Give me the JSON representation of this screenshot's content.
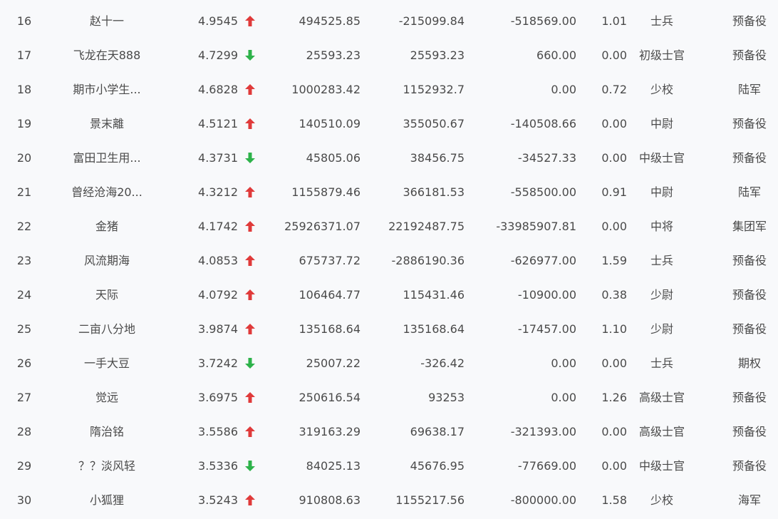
{
  "colors": {
    "up": "#e03a3a",
    "down": "#2db24a"
  },
  "rows": [
    {
      "rank": "16",
      "name": "赵十一",
      "score": "4.9545",
      "trend": "up",
      "v1": "494525.85",
      "v2": "-215099.84",
      "v3": "-518569.00",
      "v4": "1.01",
      "military_rank": "士兵",
      "branch": "预备役"
    },
    {
      "rank": "17",
      "name": "飞龙在天888",
      "score": "4.7299",
      "trend": "down",
      "v1": "25593.23",
      "v2": "25593.23",
      "v3": "660.00",
      "v4": "0.00",
      "military_rank": "初级士官",
      "branch": "预备役"
    },
    {
      "rank": "18",
      "name": "期市小学生...",
      "score": "4.6828",
      "trend": "up",
      "v1": "1000283.42",
      "v2": "1152932.7",
      "v3": "0.00",
      "v4": "0.72",
      "military_rank": "少校",
      "branch": "陆军"
    },
    {
      "rank": "19",
      "name": "景末離",
      "score": "4.5121",
      "trend": "up",
      "v1": "140510.09",
      "v2": "355050.67",
      "v3": "-140508.66",
      "v4": "0.00",
      "military_rank": "中尉",
      "branch": "预备役"
    },
    {
      "rank": "20",
      "name": "富田卫生用...",
      "score": "4.3731",
      "trend": "down",
      "v1": "45805.06",
      "v2": "38456.75",
      "v3": "-34527.33",
      "v4": "0.00",
      "military_rank": "中级士官",
      "branch": "预备役"
    },
    {
      "rank": "21",
      "name": "曾经沧海20...",
      "score": "4.3212",
      "trend": "up",
      "v1": "1155879.46",
      "v2": "366181.53",
      "v3": "-558500.00",
      "v4": "0.91",
      "military_rank": "中尉",
      "branch": "陆军"
    },
    {
      "rank": "22",
      "name": "金猪",
      "score": "4.1742",
      "trend": "up",
      "v1": "25926371.07",
      "v2": "22192487.75",
      "v3": "-33985907.81",
      "v4": "0.00",
      "military_rank": "中将",
      "branch": "集团军"
    },
    {
      "rank": "23",
      "name": "风流期海",
      "score": "4.0853",
      "trend": "up",
      "v1": "675737.72",
      "v2": "-2886190.36",
      "v3": "-626977.00",
      "v4": "1.59",
      "military_rank": "士兵",
      "branch": "预备役"
    },
    {
      "rank": "24",
      "name": "天际",
      "score": "4.0792",
      "trend": "up",
      "v1": "106464.77",
      "v2": "115431.46",
      "v3": "-10900.00",
      "v4": "0.38",
      "military_rank": "少尉",
      "branch": "预备役"
    },
    {
      "rank": "25",
      "name": "二亩八分地",
      "score": "3.9874",
      "trend": "up",
      "v1": "135168.64",
      "v2": "135168.64",
      "v3": "-17457.00",
      "v4": "1.10",
      "military_rank": "少尉",
      "branch": "预备役"
    },
    {
      "rank": "26",
      "name": "一手大豆",
      "score": "3.7242",
      "trend": "down",
      "v1": "25007.22",
      "v2": "-326.42",
      "v3": "0.00",
      "v4": "0.00",
      "military_rank": "士兵",
      "branch": "期权"
    },
    {
      "rank": "27",
      "name": "觉远",
      "score": "3.6975",
      "trend": "up",
      "v1": "250616.54",
      "v2": "93253",
      "v3": "0.00",
      "v4": "1.26",
      "military_rank": "高级士官",
      "branch": "预备役"
    },
    {
      "rank": "28",
      "name": "隋治铭",
      "score": "3.5586",
      "trend": "up",
      "v1": "319163.29",
      "v2": "69638.17",
      "v3": "-321393.00",
      "v4": "0.00",
      "military_rank": "高级士官",
      "branch": "预备役"
    },
    {
      "rank": "29",
      "name": "？？淡风轻",
      "score": "3.5336",
      "trend": "down",
      "v1": "84025.13",
      "v2": "45676.95",
      "v3": "-77669.00",
      "v4": "0.00",
      "military_rank": "中级士官",
      "branch": "预备役"
    },
    {
      "rank": "30",
      "name": "小狐狸",
      "score": "3.5243",
      "trend": "up",
      "v1": "910808.63",
      "v2": "1155217.56",
      "v3": "-800000.00",
      "v4": "1.58",
      "military_rank": "少校",
      "branch": "海军"
    }
  ]
}
